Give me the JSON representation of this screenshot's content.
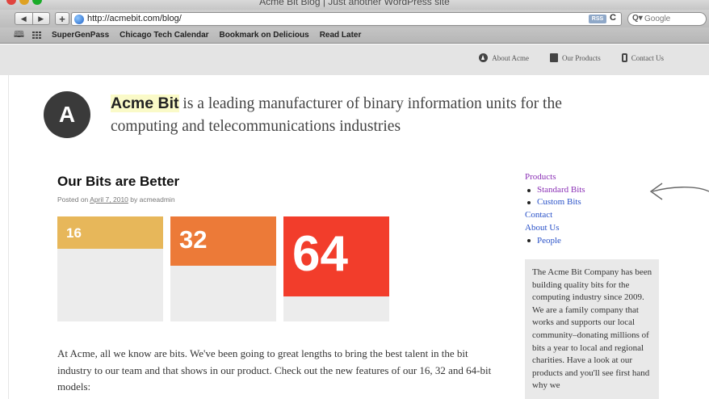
{
  "window": {
    "title": "Acme Bit Blog | Just another WordPress site"
  },
  "toolbar": {
    "back_icon": "back-arrow-icon",
    "forward_icon": "forward-arrow-icon",
    "add_label": "+",
    "url": "http://acmebit.com/blog/",
    "rss_label": "RSS",
    "reload_label": "C",
    "search_placeholder": "Google"
  },
  "bookmarks": [
    "SuperGenPass",
    "Chicago Tech Calendar",
    "Bookmark on Delicious",
    "Read Later"
  ],
  "site_nav": [
    {
      "label": "About Acme",
      "icon": "logo-circle-icon"
    },
    {
      "label": "Our Products",
      "icon": "box-icon"
    },
    {
      "label": "Contact Us",
      "icon": "phone-icon"
    }
  ],
  "header": {
    "logo_letter": "A",
    "brand": "Acme Bit",
    "tagline_rest": " is a leading manufacturer of binary information units for the computing and telecommunications industries"
  },
  "post": {
    "title": "Our Bits are Better",
    "meta_prefix": "Posted on ",
    "date": "April 7, 2010",
    "meta_by": " by ",
    "author": "acmeadmin",
    "bits": [
      {
        "label": "16",
        "color": "#e7b75a",
        "fill": 0.31
      },
      {
        "label": "32",
        "color": "#ec7a38",
        "fill": 0.47
      },
      {
        "label": "64",
        "color": "#f23d2b",
        "fill": 0.76
      }
    ],
    "body": "At Acme, all we know are bits. We've been going to great lengths to bring the best talent in the bit industry to our team and that shows in our product. Check out the new features of our 16, 32 and 64-bit models:"
  },
  "sidebar": {
    "menu": {
      "products": "Products",
      "standard_bits": "Standard Bits",
      "custom_bits": "Custom Bits",
      "contact": "Contact",
      "about_us": "About Us",
      "people": "People"
    },
    "about_text": "The Acme Bit Company has been building quality bits for the computing industry since 2009. We are a family company that works and supports our local community–donating millions of bits a year to local and regional charities. Have a look at our products and you'll see first hand why we"
  },
  "colors": {
    "link": "#2a52c8",
    "visited": "#8a2fb5",
    "brand_highlight": "#fafac8"
  }
}
